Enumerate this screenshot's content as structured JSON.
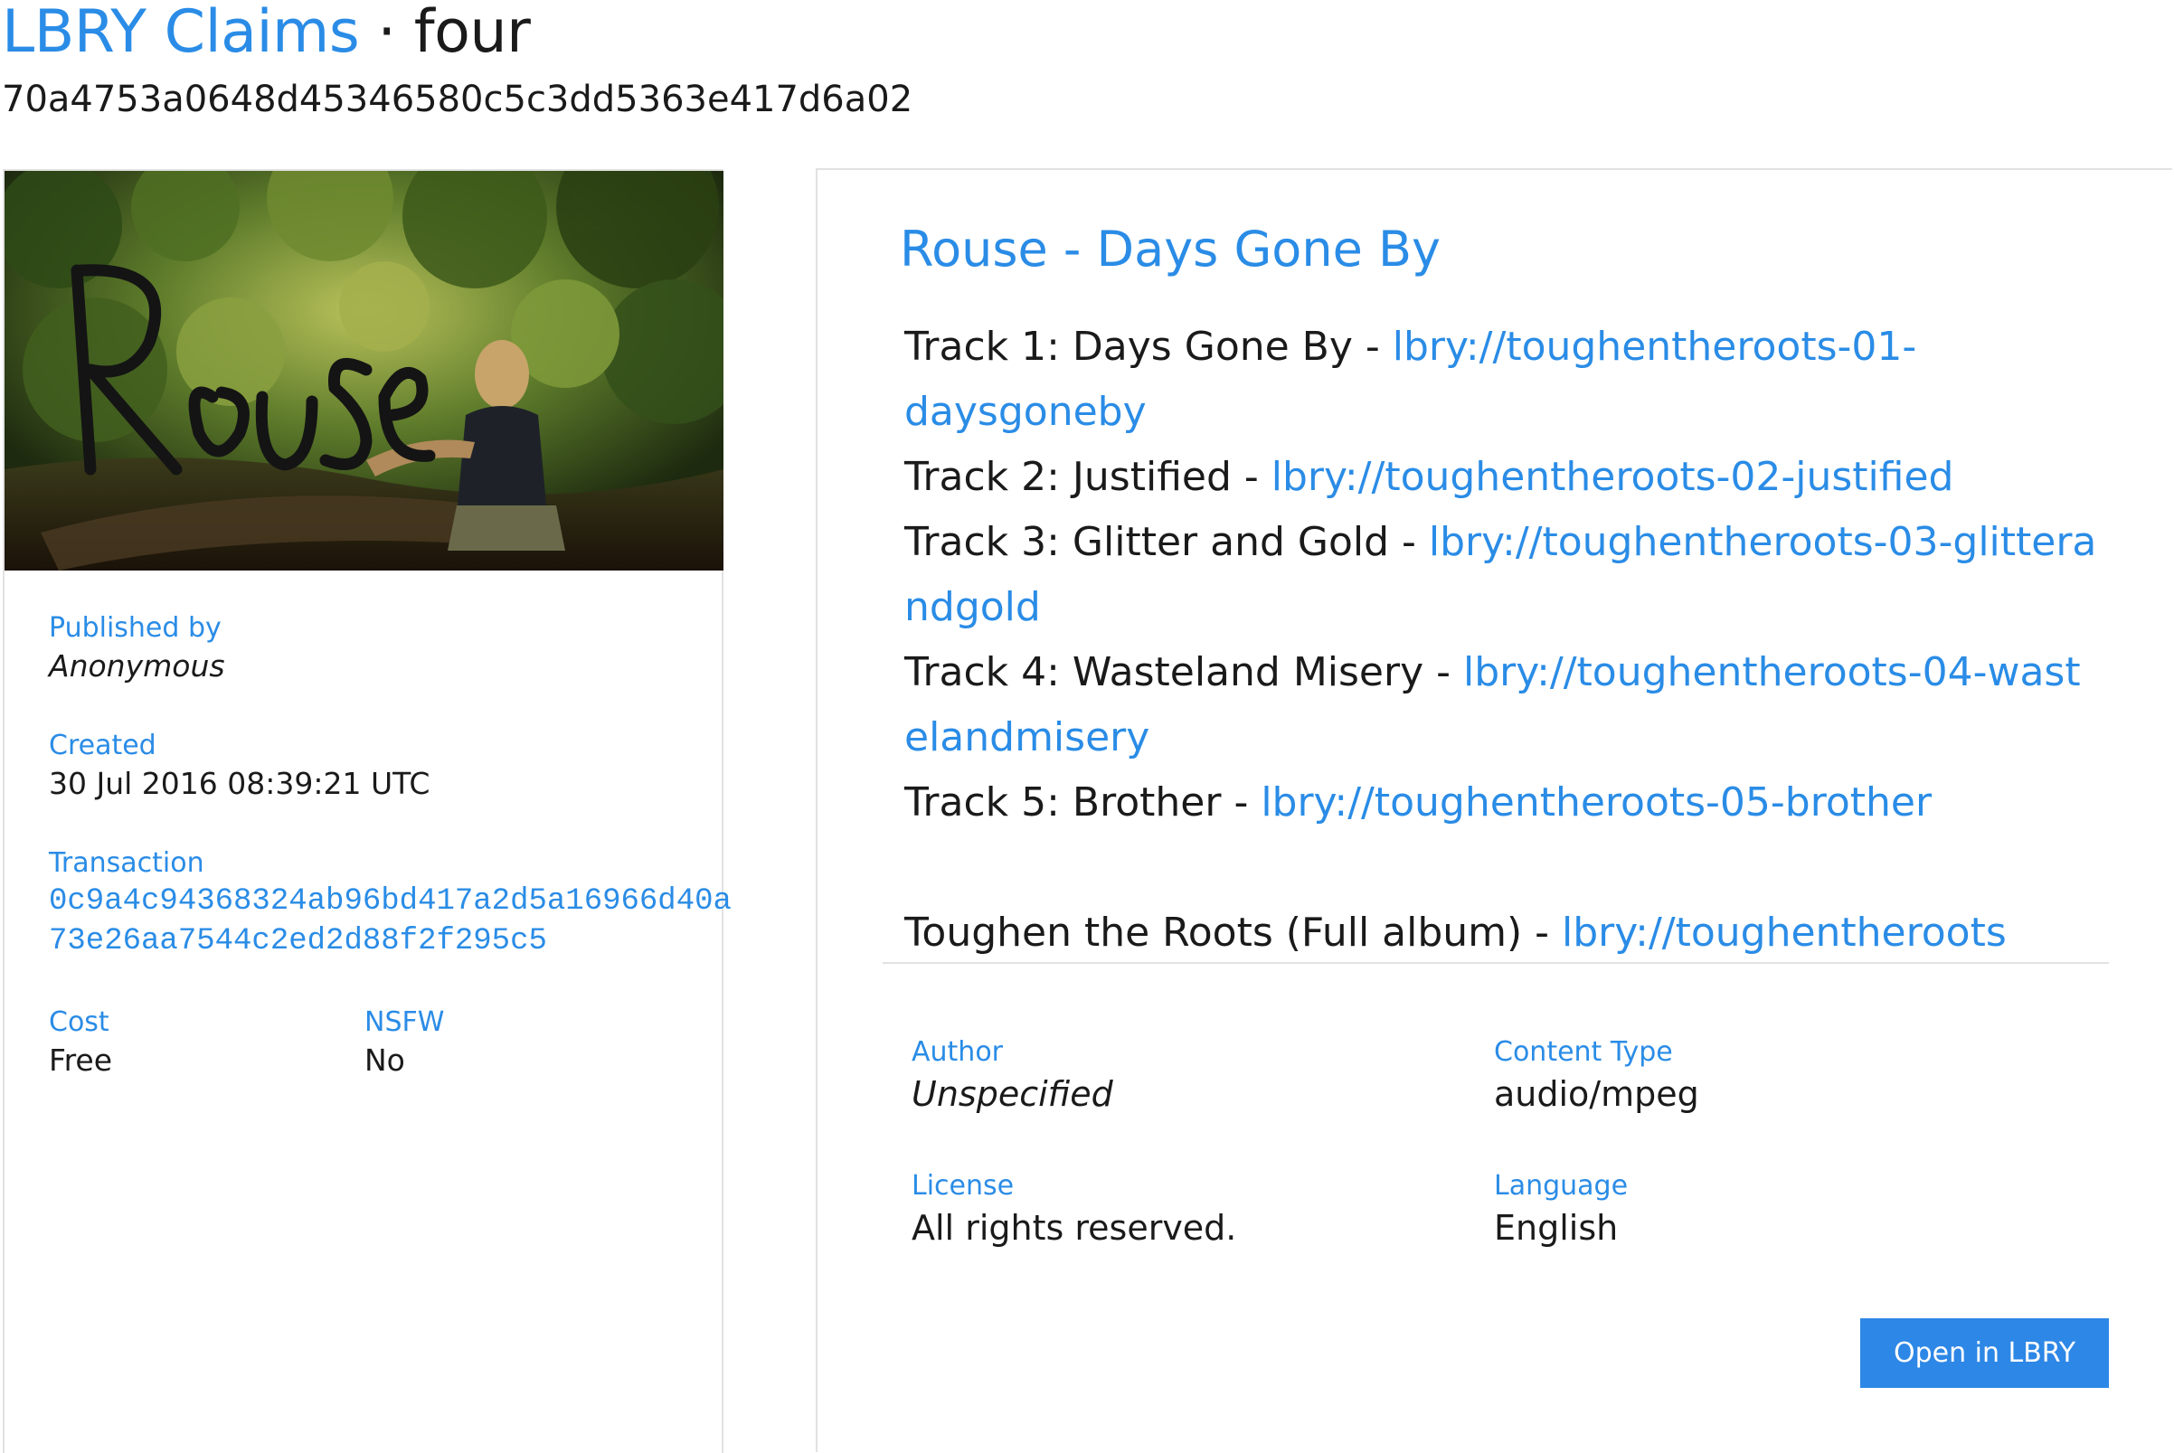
{
  "header": {
    "site_title": "LBRY Claims",
    "separator": "·",
    "claim_name": "four",
    "claim_id": "70a4753a0648d45346580c5c3dd5363e417d6a02"
  },
  "sidebar": {
    "thumbnail_alt": "Rouse",
    "published_by": {
      "label": "Published by",
      "value": "Anonymous"
    },
    "created": {
      "label": "Created",
      "value": "30 Jul 2016 08:39:21 UTC"
    },
    "transaction": {
      "label": "Transaction",
      "line1": "0c9a4c94368324ab96bd417a2d5a16966d40a",
      "line2": "73e26aa7544c2ed2d88f2f295c5"
    },
    "cost": {
      "label": "Cost",
      "value": "Free"
    },
    "nsfw": {
      "label": "NSFW",
      "value": "No"
    }
  },
  "main": {
    "title": "Rouse - Days Gone By",
    "tracks": [
      {
        "text": "Track 1: Days Gone By - ",
        "link": "lbry://toughentheroots-01-daysgoneby"
      },
      {
        "text": "Track 2: Justified - ",
        "link": "lbry://toughentheroots-02-justified"
      },
      {
        "text": "Track 3: Glitter and Gold - ",
        "link": "lbry://toughentheroots-03-glitterandgold"
      },
      {
        "text": "Track 4: Wasteland Misery - ",
        "link": "lbry://toughentheroots-04-wastelandmisery"
      },
      {
        "text": "Track 5: Brother - ",
        "link": "lbry://toughentheroots-05-brother"
      }
    ],
    "album": {
      "text": "Toughen the Roots (Full album) - ",
      "link": "lbry://toughentheroots"
    },
    "author": {
      "label": "Author",
      "value": "Unspecified"
    },
    "content_type": {
      "label": "Content Type",
      "value": "audio/mpeg"
    },
    "license": {
      "label": "License",
      "value": "All rights reserved."
    },
    "language": {
      "label": "Language",
      "value": "English"
    },
    "open_button": "Open in LBRY"
  },
  "colors": {
    "accent": "#2a8ce6",
    "button": "#2d87e6",
    "border": "#e2e2e2"
  }
}
